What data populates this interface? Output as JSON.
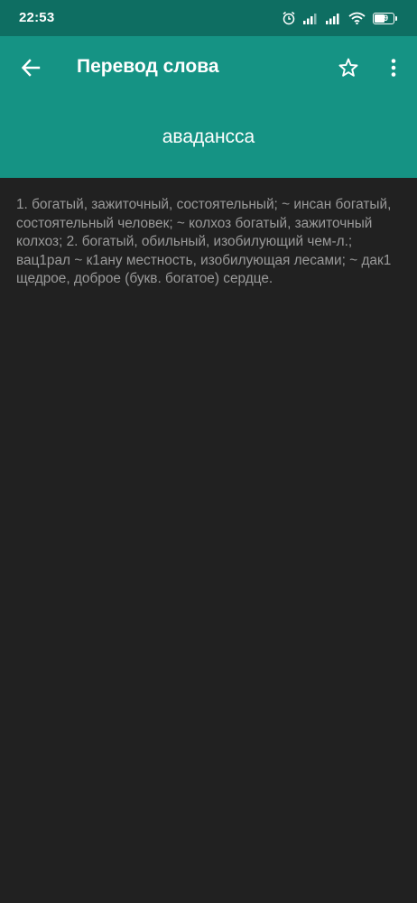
{
  "status_bar": {
    "time": "22:53",
    "battery_level": "49",
    "icons": [
      "alarm-icon",
      "signal-icon",
      "signal-icon",
      "wifi-icon",
      "battery-icon"
    ]
  },
  "app_bar": {
    "title": "Перевод слова",
    "icons": [
      "back-arrow-icon",
      "star-outline-icon",
      "more-vert-icon"
    ]
  },
  "word": {
    "headword": "авадансса"
  },
  "translation": {
    "text": "1. богатый, зажиточный, состоятельный; ~ инсан богатый, состоятельный человек; ~ колхоз богатый, зажиточный колхоз; 2. богатый, обильный, изобилующий чем-л.; вац1рал ~ к1ану местность, изобилующая лесами;  ~ дак1 щедрое, доброе (букв. богатое) сердце."
  },
  "colors": {
    "status_bar": "#0e6e62",
    "app_bar": "#159384",
    "background": "#212121",
    "text": "#9a9a9a"
  }
}
